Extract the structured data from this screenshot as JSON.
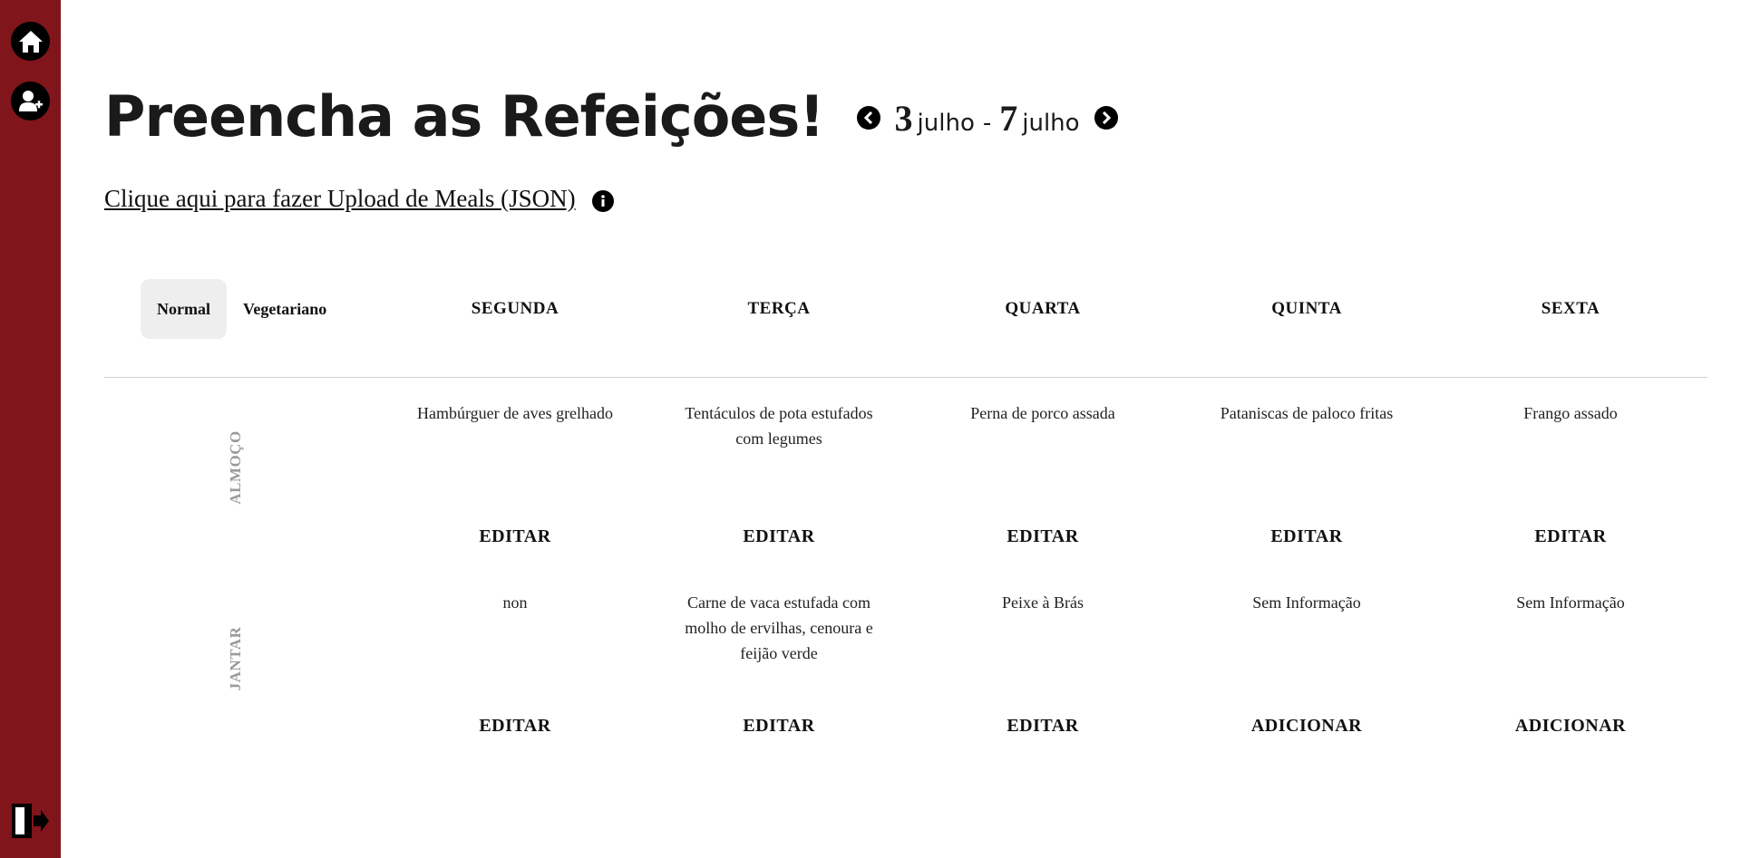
{
  "sidebar": {
    "home_icon": "home-icon",
    "add_user_icon": "user-plus-icon",
    "logout_icon": "logout-icon",
    "color": "#80161b"
  },
  "header": {
    "title": "Preencha as Refeições!",
    "week": {
      "start_day": "3",
      "start_month": "julho",
      "separator": "-",
      "end_day": "7",
      "end_month": "julho"
    }
  },
  "upload": {
    "link_text": "Clique aqui para fazer Upload de Meals (JSON)"
  },
  "menu_toggle": {
    "options": [
      "Normal",
      "Vegetariano"
    ],
    "selected": "Normal"
  },
  "days": [
    "SEGUNDA",
    "TERÇA",
    "QUARTA",
    "QUINTA",
    "SEXTA"
  ],
  "meals": [
    {
      "label": "ALMOÇO",
      "items": [
        {
          "dish": "Hambúrguer de aves grelhado",
          "action": "EDITAR"
        },
        {
          "dish": "Tentáculos de pota estufados com legumes",
          "action": "EDITAR"
        },
        {
          "dish": "Perna de porco assada",
          "action": "EDITAR"
        },
        {
          "dish": "Pataniscas de paloco fritas",
          "action": "EDITAR"
        },
        {
          "dish": "Frango assado",
          "action": "EDITAR"
        }
      ]
    },
    {
      "label": "JANTAR",
      "items": [
        {
          "dish": "non",
          "action": "EDITAR"
        },
        {
          "dish": "Carne de vaca estufada com molho de ervilhas, cenoura e feijão verde",
          "action": "EDITAR"
        },
        {
          "dish": "Peixe à Brás",
          "action": "EDITAR"
        },
        {
          "dish": "Sem Informação",
          "action": "ADICIONAR"
        },
        {
          "dish": "Sem Informação",
          "action": "ADICIONAR"
        }
      ]
    }
  ]
}
